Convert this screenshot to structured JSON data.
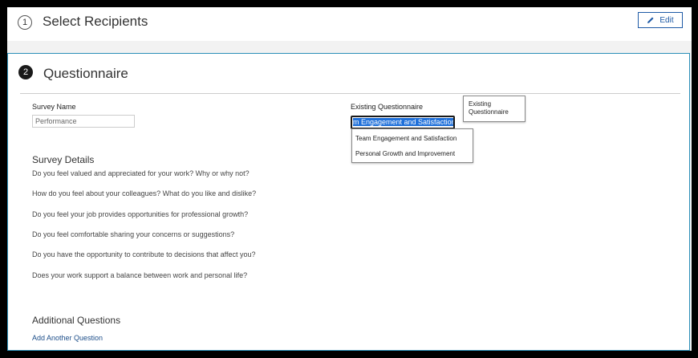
{
  "step1": {
    "number": "1",
    "title": "Select Recipients",
    "edit_label": "Edit"
  },
  "step2": {
    "number": "2",
    "title": "Questionnaire"
  },
  "form": {
    "survey_name_label": "Survey Name",
    "survey_name_value": "Performance",
    "existing_label": "Existing Questionnaire",
    "existing_value": "m Engagement and Satisfaction",
    "dropdown_options": [
      "Team Engagement and Satisfaction",
      "Personal Growth and Improvement"
    ],
    "tooltip_line1": "Existing",
    "tooltip_line2": "Questionnaire"
  },
  "survey_details": {
    "title": "Survey Details",
    "questions": [
      "Do you feel valued and appreciated for your work? Why or why not?",
      "How do you feel about your colleagues? What do you like and dislike?",
      "Do you feel your job provides opportunities for professional growth?",
      "Do you feel comfortable sharing your concerns or suggestions?",
      "Do you have the opportunity to contribute to decisions that affect you?",
      "Does your work support a balance between work and personal life?"
    ]
  },
  "additional": {
    "title": "Additional Questions",
    "add_link": "Add Another Question"
  },
  "colors": {
    "accent": "#2b8fb8",
    "link": "#1e4f8a",
    "selection": "#1e6fd9"
  }
}
